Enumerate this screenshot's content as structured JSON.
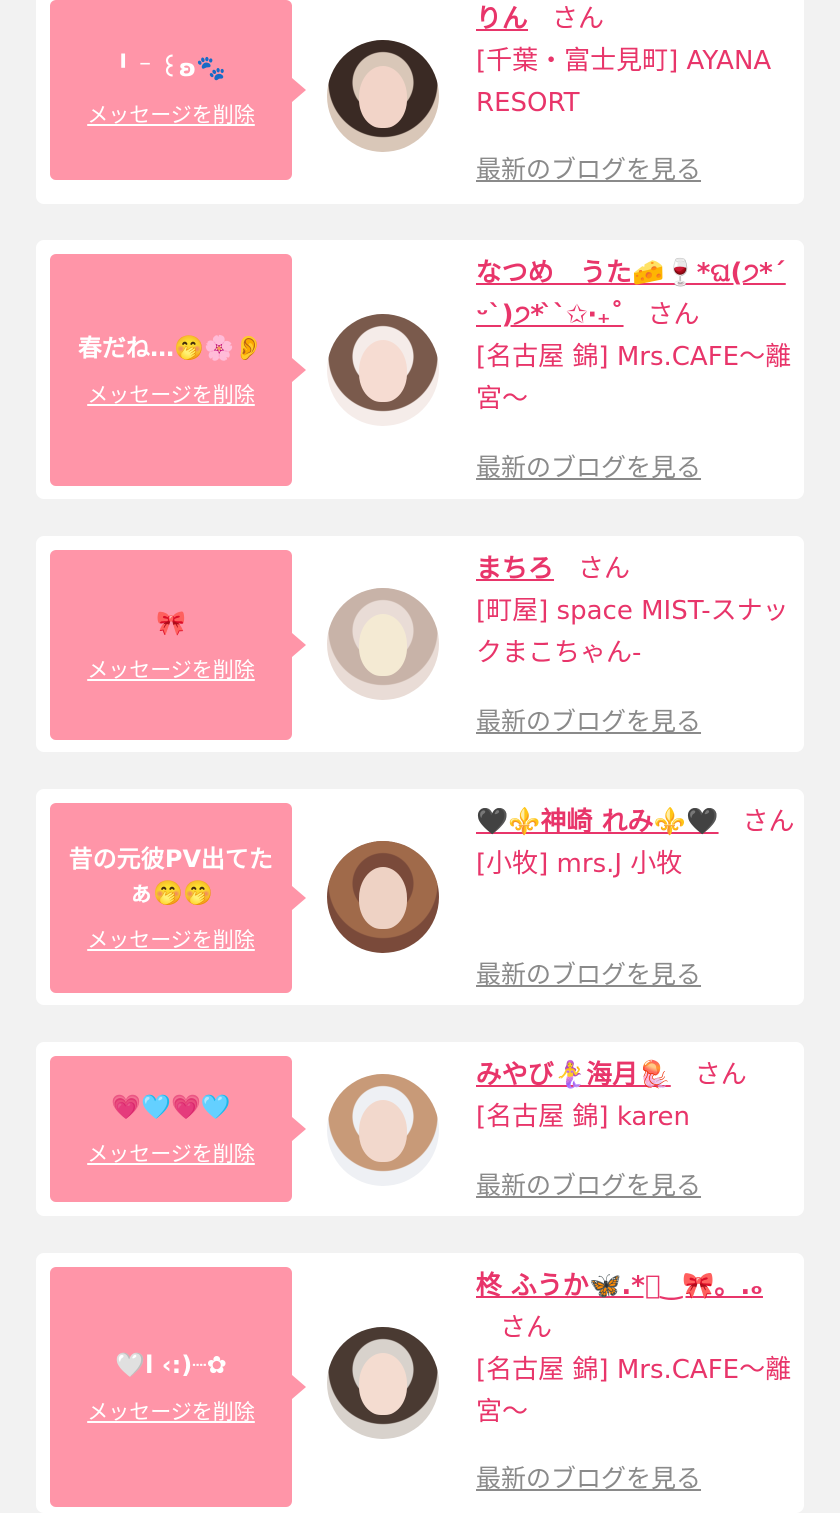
{
  "items": [
    {
      "message": "╹ ⁻ ꒰ʚ🐾",
      "delete_label": "メッセージを削除",
      "name": "りん",
      "san": "さん",
      "shop": "[千葉・富士見町] AYANA RESORT",
      "blog_label": "最新のブログを見る",
      "avatar_bg": "#d9c7b8",
      "avatar_hair": "#3a2a24",
      "avatar_face": "#f2d4c8"
    },
    {
      "message": "春だね…🤭🌸👂",
      "delete_label": "メッセージを削除",
      "name": "なつめ　うた🧀🍷*ଘ(੭*ˊᵕˋ)੭* ̀ˋ✩‧₊˚",
      "san": "さん",
      "shop": "[名古屋 錦] Mrs.CAFE〜離宮〜",
      "blog_label": "最新のブログを見る",
      "avatar_bg": "#f5ece9",
      "avatar_hair": "#7a5a4c",
      "avatar_face": "#f6dcd2"
    },
    {
      "message": "🎀",
      "delete_label": "メッセージを削除",
      "name": "まちろ",
      "san": "さん",
      "shop": "[町屋] space MIST-スナックまこちゃん-",
      "blog_label": "最新のブログを見る",
      "avatar_bg": "#e9dcd6",
      "avatar_hair": "#c8b3a8",
      "avatar_face": "#f4ead3"
    },
    {
      "message": "昔の元彼PV出てたぁ🤭🤭",
      "delete_label": "メッセージを削除",
      "name": "🖤⚜️神崎 れみ⚜️🖤",
      "san": "さん",
      "shop": "[小牧] mrs.J 小牧",
      "blog_label": "最新のブログを見る",
      "avatar_bg": "#7a4a3a",
      "avatar_hair": "#a06a4a",
      "avatar_face": "#eed2c4"
    },
    {
      "message": "💗🩵💗🩵",
      "delete_label": "メッセージを削除",
      "name": "みやび🧜‍♀️海月🪼",
      "san": "さん",
      "shop": "[名古屋 錦] karen",
      "blog_label": "最新のブログを見る",
      "avatar_bg": "#eef0f4",
      "avatar_hair": "#c89a78",
      "avatar_face": "#f2d8cc"
    },
    {
      "message": "🤍l ‹:)┈✿",
      "delete_label": "メッセージを削除",
      "name": "柊 ふうか🦋.*ﾟ‿🎀。.ₒ",
      "san": "さん",
      "shop": "[名古屋 錦] Mrs.CAFE〜離宮〜",
      "blog_label": "最新のブログを見る",
      "avatar_bg": "#d8d2cc",
      "avatar_hair": "#4a3a32",
      "avatar_face": "#f4dcd0"
    }
  ]
}
